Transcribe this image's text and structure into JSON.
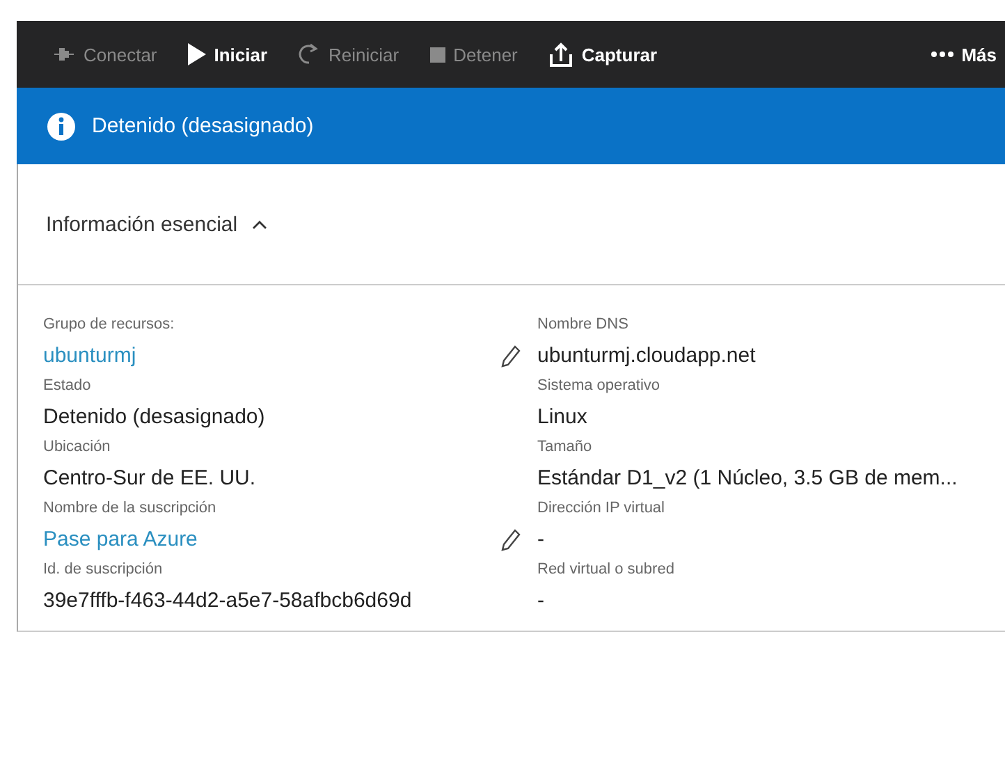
{
  "toolbar": [
    {
      "kind": "connect",
      "label": "Conectar",
      "disabled": true
    },
    {
      "kind": "start",
      "label": "Iniciar",
      "disabled": false
    },
    {
      "kind": "restart",
      "label": "Reiniciar",
      "disabled": true
    },
    {
      "kind": "stop",
      "label": "Detener",
      "disabled": true
    },
    {
      "kind": "capture",
      "label": "Capturar",
      "disabled": false
    }
  ],
  "more": {
    "label": "Más"
  },
  "status_banner": {
    "text": "Detenido (desasignado)"
  },
  "essentials": {
    "title": "Información esencial",
    "expanded": true,
    "left": [
      {
        "label": "Grupo de recursos:",
        "value": "ubunturmj",
        "link": true,
        "editable": true
      },
      {
        "label": "Estado",
        "value": "Detenido (desasignado)",
        "link": false,
        "editable": false
      },
      {
        "label": "Ubicación",
        "value": "Centro-Sur de EE. UU.",
        "link": false,
        "editable": false
      },
      {
        "label": "Nombre de la suscripción",
        "value": "Pase para Azure",
        "link": true,
        "editable": true
      },
      {
        "label": "Id. de suscripción",
        "value": "39e7fffb-f463-44d2-a5e7-58afbcb6d69d",
        "link": false,
        "editable": false
      }
    ],
    "right": [
      {
        "label": "Nombre DNS",
        "value": "ubunturmj.cloudapp.net",
        "link": false,
        "editable": false
      },
      {
        "label": "Sistema operativo",
        "value": "Linux",
        "link": false,
        "editable": false
      },
      {
        "label": "Tamaño",
        "value": "Estándar D1_v2 (1 Núcleo, 3.5 GB de mem...",
        "link": false,
        "editable": false
      },
      {
        "label": "Dirección IP virtual",
        "value": "-",
        "link": false,
        "editable": false
      },
      {
        "label": "Red virtual o subred",
        "value": "-",
        "link": false,
        "editable": false
      }
    ]
  }
}
